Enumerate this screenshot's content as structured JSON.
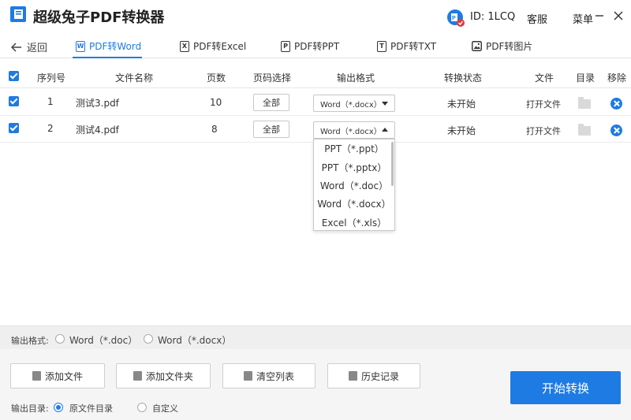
{
  "app": {
    "title": "超级兔子PDF转换器"
  },
  "user": {
    "id_label": "ID: 1LCQ"
  },
  "top_links": {
    "service": "客服",
    "menu": "菜单"
  },
  "nav": {
    "back_label": "返回"
  },
  "tabs": [
    {
      "label": "PDF转Word",
      "icon": "W",
      "active": true
    },
    {
      "label": "PDF转Excel",
      "icon": "X",
      "active": false
    },
    {
      "label": "PDF转PPT",
      "icon": "P",
      "active": false
    },
    {
      "label": "PDF转TXT",
      "icon": "T",
      "active": false
    },
    {
      "label": "PDF转图片",
      "icon": "img",
      "active": false
    }
  ],
  "table": {
    "headers": {
      "index": "序列号",
      "filename": "文件名称",
      "pages": "页数",
      "page_select": "页码选择",
      "output_format": "输出格式",
      "status": "转换状态",
      "file": "文件",
      "directory": "目录",
      "remove": "移除"
    },
    "rows": [
      {
        "index": "1",
        "filename": "测试3.pdf",
        "pages": "10",
        "page_select": "全部",
        "format": "Word（*.docx）",
        "status": "未开始",
        "file_action": "打开文件"
      },
      {
        "index": "2",
        "filename": "测试4.pdf",
        "pages": "8",
        "page_select": "全部",
        "format": "Word（*.docx）",
        "status": "未开始",
        "file_action": "打开文件"
      }
    ]
  },
  "dropdown": {
    "options": [
      "PPT（*.ppt）",
      "PPT（*.pptx）",
      "Word（*.doc）",
      "Word（*.docx）",
      "Excel（*.xls）"
    ]
  },
  "output_format_bar": {
    "label": "输出格式:",
    "options": [
      "Word（*.doc）",
      "Word（*.docx）"
    ]
  },
  "actions": {
    "add_file": "添加文件",
    "add_folder": "添加文件夹",
    "clear_list": "清空列表",
    "history": "历史记录",
    "start": "开始转换"
  },
  "output_dir": {
    "label": "输出目录:",
    "options": [
      "原文件目录",
      "自定义"
    ]
  },
  "colors": {
    "accent": "#1e7be3",
    "logo": "#1e7be3",
    "avatar_badge": "#e03a3a"
  }
}
